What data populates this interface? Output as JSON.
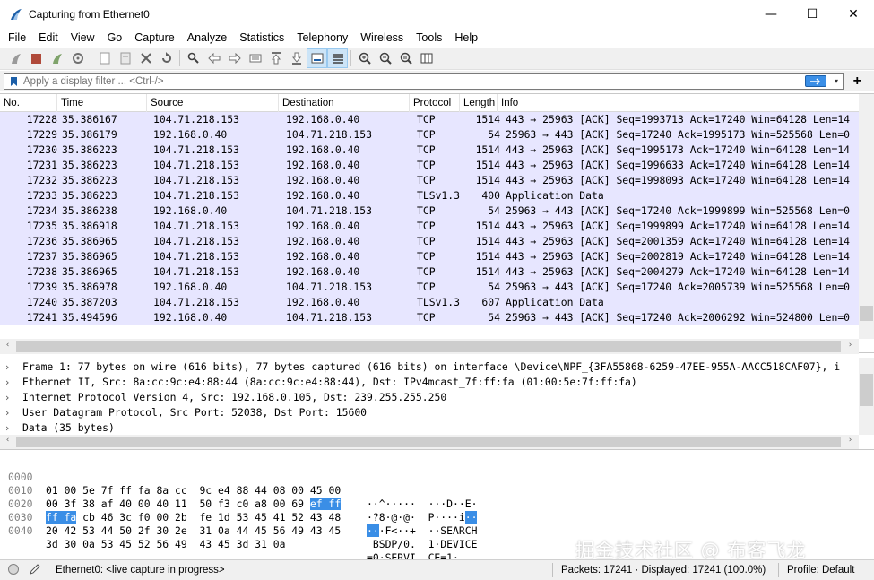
{
  "window": {
    "title": "Capturing from Ethernet0",
    "minimize": "—",
    "maximize": "☐",
    "close": "✕"
  },
  "menu": [
    "File",
    "Edit",
    "View",
    "Go",
    "Capture",
    "Analyze",
    "Statistics",
    "Telephony",
    "Wireless",
    "Tools",
    "Help"
  ],
  "filter": {
    "placeholder": "Apply a display filter ... <Ctrl-/>",
    "plus": "+"
  },
  "columns": {
    "no": "No.",
    "time": "Time",
    "source": "Source",
    "destination": "Destination",
    "protocol": "Protocol",
    "length": "Length",
    "info": "Info"
  },
  "packets": [
    {
      "no": "17228",
      "time": "35.386167",
      "src": "104.71.218.153",
      "dst": "192.168.0.40",
      "proto": "TCP",
      "len": "1514",
      "info": "443 → 25963 [ACK] Seq=1993713 Ack=17240 Win=64128 Len=14"
    },
    {
      "no": "17229",
      "time": "35.386179",
      "src": "192.168.0.40",
      "dst": "104.71.218.153",
      "proto": "TCP",
      "len": "54",
      "info": "25963 → 443 [ACK] Seq=17240 Ack=1995173 Win=525568 Len=0"
    },
    {
      "no": "17230",
      "time": "35.386223",
      "src": "104.71.218.153",
      "dst": "192.168.0.40",
      "proto": "TCP",
      "len": "1514",
      "info": "443 → 25963 [ACK] Seq=1995173 Ack=17240 Win=64128 Len=14"
    },
    {
      "no": "17231",
      "time": "35.386223",
      "src": "104.71.218.153",
      "dst": "192.168.0.40",
      "proto": "TCP",
      "len": "1514",
      "info": "443 → 25963 [ACK] Seq=1996633 Ack=17240 Win=64128 Len=14"
    },
    {
      "no": "17232",
      "time": "35.386223",
      "src": "104.71.218.153",
      "dst": "192.168.0.40",
      "proto": "TCP",
      "len": "1514",
      "info": "443 → 25963 [ACK] Seq=1998093 Ack=17240 Win=64128 Len=14"
    },
    {
      "no": "17233",
      "time": "35.386223",
      "src": "104.71.218.153",
      "dst": "192.168.0.40",
      "proto": "TLSv1.3",
      "len": "400",
      "info": "Application Data"
    },
    {
      "no": "17234",
      "time": "35.386238",
      "src": "192.168.0.40",
      "dst": "104.71.218.153",
      "proto": "TCP",
      "len": "54",
      "info": "25963 → 443 [ACK] Seq=17240 Ack=1999899 Win=525568 Len=0"
    },
    {
      "no": "17235",
      "time": "35.386918",
      "src": "104.71.218.153",
      "dst": "192.168.0.40",
      "proto": "TCP",
      "len": "1514",
      "info": "443 → 25963 [ACK] Seq=1999899 Ack=17240 Win=64128 Len=14"
    },
    {
      "no": "17236",
      "time": "35.386965",
      "src": "104.71.218.153",
      "dst": "192.168.0.40",
      "proto": "TCP",
      "len": "1514",
      "info": "443 → 25963 [ACK] Seq=2001359 Ack=17240 Win=64128 Len=14"
    },
    {
      "no": "17237",
      "time": "35.386965",
      "src": "104.71.218.153",
      "dst": "192.168.0.40",
      "proto": "TCP",
      "len": "1514",
      "info": "443 → 25963 [ACK] Seq=2002819 Ack=17240 Win=64128 Len=14"
    },
    {
      "no": "17238",
      "time": "35.386965",
      "src": "104.71.218.153",
      "dst": "192.168.0.40",
      "proto": "TCP",
      "len": "1514",
      "info": "443 → 25963 [ACK] Seq=2004279 Ack=17240 Win=64128 Len=14"
    },
    {
      "no": "17239",
      "time": "35.386978",
      "src": "192.168.0.40",
      "dst": "104.71.218.153",
      "proto": "TCP",
      "len": "54",
      "info": "25963 → 443 [ACK] Seq=17240 Ack=2005739 Win=525568 Len=0"
    },
    {
      "no": "17240",
      "time": "35.387203",
      "src": "104.71.218.153",
      "dst": "192.168.0.40",
      "proto": "TLSv1.3",
      "len": "607",
      "info": "Application Data"
    },
    {
      "no": "17241",
      "time": "35.494596",
      "src": "192.168.0.40",
      "dst": "104.71.218.153",
      "proto": "TCP",
      "len": "54",
      "info": "25963 → 443 [ACK] Seq=17240 Ack=2006292 Win=524800 Len=0"
    }
  ],
  "details": [
    "Frame 1: 77 bytes on wire (616 bits), 77 bytes captured (616 bits) on interface \\Device\\NPF_{3FA55868-6259-47EE-955A-AACC518CAF07}, i",
    "Ethernet II, Src: 8a:cc:9c:e4:88:44 (8a:cc:9c:e4:88:44), Dst: IPv4mcast_7f:ff:fa (01:00:5e:7f:ff:fa)",
    "Internet Protocol Version 4, Src: 192.168.0.105, Dst: 239.255.255.250",
    "User Datagram Protocol, Src Port: 52038, Dst Port: 15600",
    "Data (35 bytes)"
  ],
  "bytes": [
    {
      "offset": "0000",
      "hex_a": "01 00 5e 7f ff fa 8a cc  9c e4 88 44 08 00 45 00",
      "hex_hl": "",
      "ascii_a": "··^·····  ···D··E·",
      "ascii_hl": ""
    },
    {
      "offset": "0010",
      "hex_a": "00 3f 38 af 40 00 40 11  50 f3 c0 a8 00 69 ",
      "hex_hl": "ef ff",
      "ascii_a": "·?8·@·@·  P····i",
      "ascii_hl": "··"
    },
    {
      "offset": "0020",
      "hex_a": "",
      "hex_hl": "ff fa",
      "hex_b": " cb 46 3c f0 00 2b  fe 1d 53 45 41 52 43 48",
      "ascii_a": "",
      "ascii_hl2": "··",
      "ascii_b": "·F<··+  ··SEARCH"
    },
    {
      "offset": "0030",
      "hex_a": "20 42 53 44 50 2f 30 2e  31 0a 44 45 56 49 43 45",
      "hex_hl": "",
      "ascii_a": " BSDP/0.  1·DEVICE",
      "ascii_hl": ""
    },
    {
      "offset": "0040",
      "hex_a": "3d 30 0a 53 45 52 56 49  43 45 3d 31 0a",
      "hex_hl": "",
      "ascii_a": "=0·SERVI  CE=1·",
      "ascii_hl": ""
    }
  ],
  "watermark": "掘金技术社区 @ 布客飞龙",
  "status": {
    "interface": "Ethernet0: <live capture in progress>",
    "packets": "Packets: 17241 · Displayed: 17241 (100.0%)",
    "profile": "Profile: Default"
  },
  "colors": {
    "tcp_row": "#e7e6ff",
    "highlight": "#3a8ee6"
  }
}
